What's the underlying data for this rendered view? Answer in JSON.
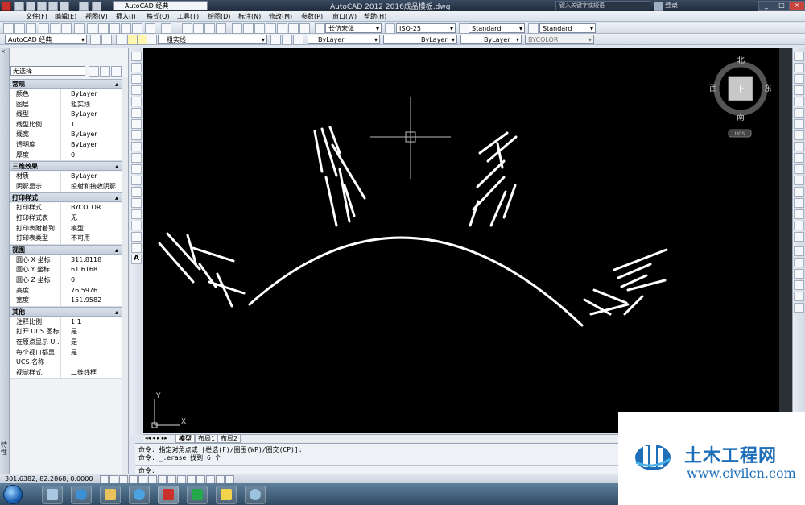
{
  "app": {
    "title": "AutoCAD 2012    2016成品模板.dwg",
    "workspace": "AutoCAD 经典",
    "search_placeholder": "键入关键字或短语",
    "login": "登录"
  },
  "menu": [
    "文件(F)",
    "编辑(E)",
    "视图(V)",
    "插入(I)",
    "格式(O)",
    "工具(T)",
    "绘图(D)",
    "标注(N)",
    "修改(M)",
    "参数(P)",
    "窗口(W)",
    "帮助(H)"
  ],
  "toolbar": {
    "workspace_combo": "AutoCAD 经典",
    "layer_combo": "粗实线",
    "text_style": "长仿宋体",
    "dim_style": "ISO-25",
    "table_style": "Standard",
    "multileader_style": "Standard",
    "color": "ByLayer",
    "linetype": "ByLayer",
    "lineweight": "ByLayer",
    "plotstyle": "BYCOLOR"
  },
  "properties": {
    "panel_title": "特性",
    "selection": "无选择",
    "sections": [
      {
        "name": "常规",
        "rows": [
          [
            "颜色",
            "ByLayer"
          ],
          [
            "图层",
            "粗实线"
          ],
          [
            "线型",
            "ByLayer"
          ],
          [
            "线型比例",
            "1"
          ],
          [
            "线宽",
            "ByLayer"
          ],
          [
            "透明度",
            "ByLayer"
          ],
          [
            "厚度",
            "0"
          ]
        ]
      },
      {
        "name": "三维效果",
        "rows": [
          [
            "材质",
            "ByLayer"
          ],
          [
            "阴影显示",
            "投射和接收阴影"
          ]
        ]
      },
      {
        "name": "打印样式",
        "rows": [
          [
            "打印样式",
            "BYCOLOR"
          ],
          [
            "打印样式表",
            "无"
          ],
          [
            "打印表附着到",
            "模型"
          ],
          [
            "打印表类型",
            "不可用"
          ]
        ]
      },
      {
        "name": "视图",
        "rows": [
          [
            "圆心 X 坐标",
            "311.8118"
          ],
          [
            "圆心 Y 坐标",
            "61.6168"
          ],
          [
            "圆心 Z 坐标",
            "0"
          ],
          [
            "高度",
            "76.5976"
          ],
          [
            "宽度",
            "151.9582"
          ]
        ]
      },
      {
        "name": "其他",
        "rows": [
          [
            "注释比例",
            "1:1"
          ],
          [
            "打开 UCS 图标",
            "是"
          ],
          [
            "在原点显示 U...",
            "是"
          ],
          [
            "每个视口都显...",
            "是"
          ],
          [
            "UCS 名称",
            ""
          ],
          [
            "视觉样式",
            "二维线框"
          ]
        ]
      }
    ]
  },
  "viewcube": {
    "north": "北",
    "south": "南",
    "east": "东",
    "west": "西",
    "face": "上",
    "ucs": "UCS"
  },
  "canvas": {
    "axis_y": "Y",
    "axis_x": "X"
  },
  "layout_tabs": [
    "模型",
    "布局1",
    "布局2"
  ],
  "command": {
    "line1": "命令: 指定对角点或 [栏选(F)/圈围(WP)/圈交(CP)]:",
    "line2": "命令: _.erase 找到 6 个",
    "prompt": "命令:"
  },
  "status": {
    "coords": "301.6382,  82.2868,  0.0000"
  },
  "watermark": {
    "title": "土木工程网",
    "url": "www.civilcn.com",
    "brand_color": "#1e6fb8"
  }
}
